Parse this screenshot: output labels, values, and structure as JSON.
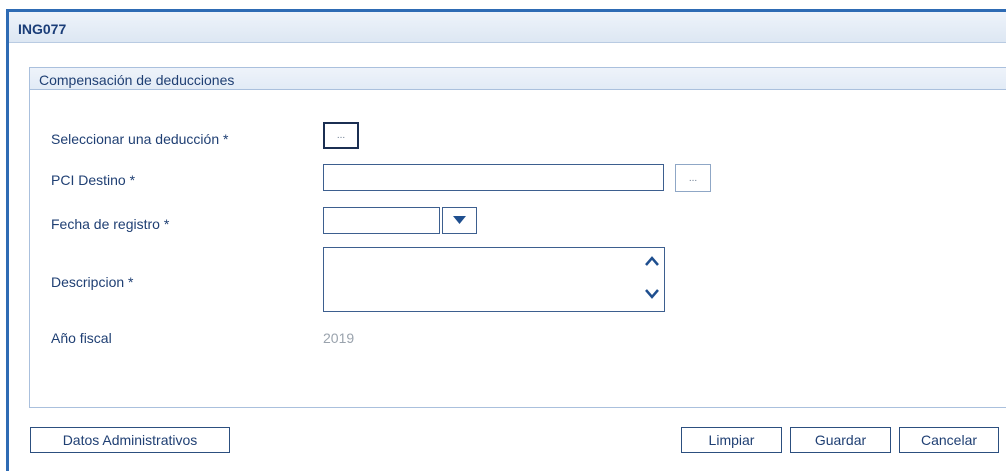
{
  "window": {
    "title": "ING077"
  },
  "group": {
    "title": "Compensación de deducciones"
  },
  "form": {
    "deduccion_label": "Seleccionar una deducción *",
    "pci_label": "PCI Destino *",
    "fecha_label": "Fecha de registro *",
    "descripcion_label": "Descripcion *",
    "anio_label": "Año fiscal",
    "anio_value": "2019",
    "dots": "...",
    "pci_value": "",
    "fecha_value": "",
    "descripcion_value": ""
  },
  "footer": {
    "datos_label": "Datos Administrativos",
    "limpiar_label": "Limpiar",
    "guardar_label": "Guardar",
    "cancelar_label": "Cancelar"
  }
}
